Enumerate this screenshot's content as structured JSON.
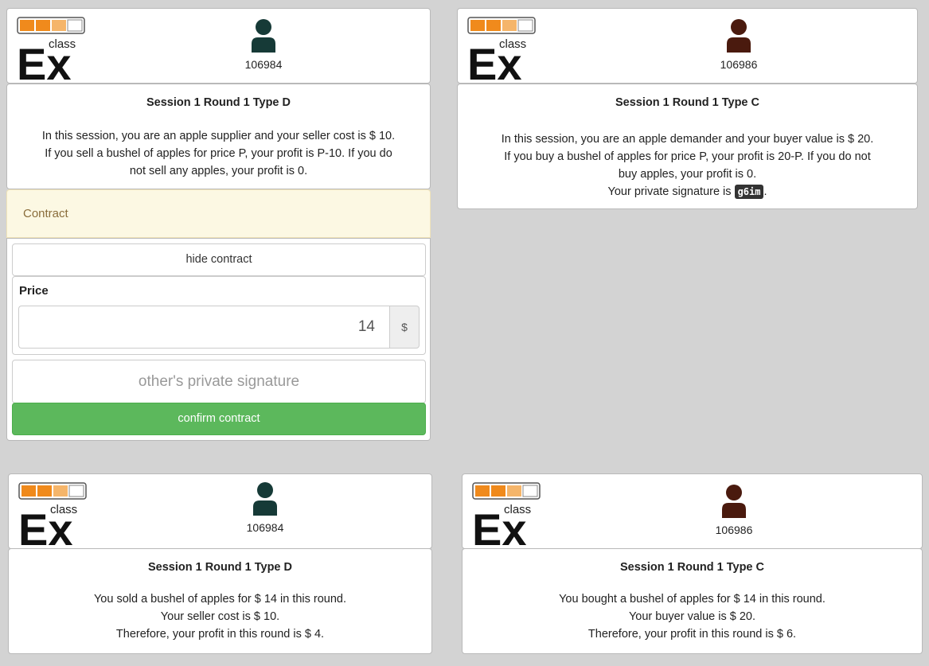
{
  "colors": {
    "supplier_avatar": "#163a37",
    "demander_avatar": "#4a1a0e",
    "confirm_button": "#5cb85c",
    "contract_panel": "#fcf8e3"
  },
  "logo": {
    "small": "class",
    "big": "Ex"
  },
  "panels": {
    "top_left": {
      "user_id": "106984",
      "title": "Session 1 Round 1 Type D",
      "lines": [
        "In this session, you are an apple supplier and your seller cost is $ 10.",
        "If you sell a bushel of apples for price P, your profit is P-10. If you do",
        "not sell any apples, your profit is 0."
      ]
    },
    "top_right": {
      "user_id": "106986",
      "title": "Session 1 Round 1 Type C",
      "lines": [
        "In this session, you are an apple demander and your buyer value is $ 20.",
        "If you buy a bushel of apples for price P, your profit is 20-P. If you do not",
        "buy apples, your profit is 0."
      ],
      "signature_prefix": "Your private signature is",
      "signature": "g6im",
      "signature_suffix": "."
    },
    "bottom_left": {
      "user_id": "106984",
      "title": "Session 1 Round 1 Type D",
      "lines": [
        "You sold a bushel of apples for $ 14 in this round.",
        "Your seller cost is $ 10.",
        "Therefore, your profit in this round is $ 4."
      ]
    },
    "bottom_right": {
      "user_id": "106986",
      "title": "Session 1 Round 1 Type C",
      "lines": [
        "You bought a bushel of apples for $ 14 in this round.",
        "Your buyer value is $ 20.",
        "Therefore, your profit in this round is $ 6."
      ]
    }
  },
  "contract": {
    "heading": "Contract",
    "hide_label": "hide contract",
    "price_label": "Price",
    "price_value": "14",
    "currency": "$",
    "signature_placeholder": "other's private signature",
    "confirm_label": "confirm contract"
  }
}
